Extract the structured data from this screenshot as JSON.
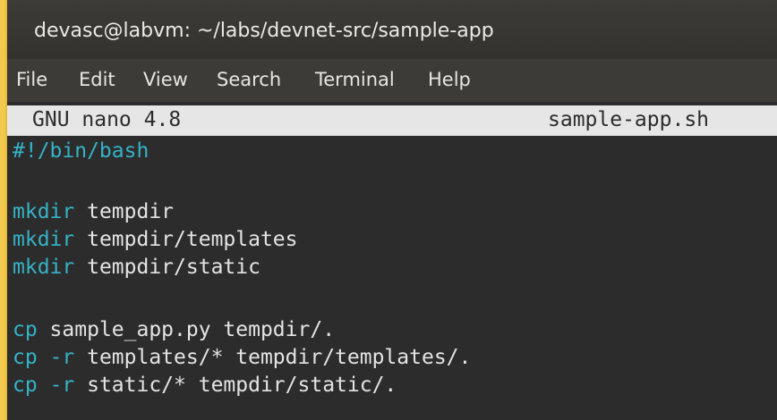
{
  "window": {
    "title": "devasc@labvm: ~/labs/devnet-src/sample-app"
  },
  "menu": {
    "items": [
      "File",
      "Edit",
      "View",
      "Search",
      "Terminal",
      "Help"
    ]
  },
  "nano": {
    "version": "GNU nano 4.8",
    "filename": "sample-app.sh"
  },
  "code": {
    "shebang": "#!/bin/bash",
    "lines": [
      {
        "cmd": "mkdir",
        "flag": "",
        "args": " tempdir"
      },
      {
        "cmd": "mkdir",
        "flag": "",
        "args": " tempdir/templates"
      },
      {
        "cmd": "mkdir",
        "flag": "",
        "args": " tempdir/static"
      },
      {
        "cmd": "cp",
        "flag": "",
        "args": " sample_app.py tempdir/."
      },
      {
        "cmd": "cp",
        "flag": " -r",
        "args": " templates/* tempdir/templates/."
      },
      {
        "cmd": "cp",
        "flag": " -r",
        "args": " static/* tempdir/static/."
      }
    ]
  },
  "colors": {
    "keyword": "#34b3c6",
    "text": "#e4e4e4",
    "background": "#2c2c2c",
    "header_bar": "#e6e6e6"
  }
}
